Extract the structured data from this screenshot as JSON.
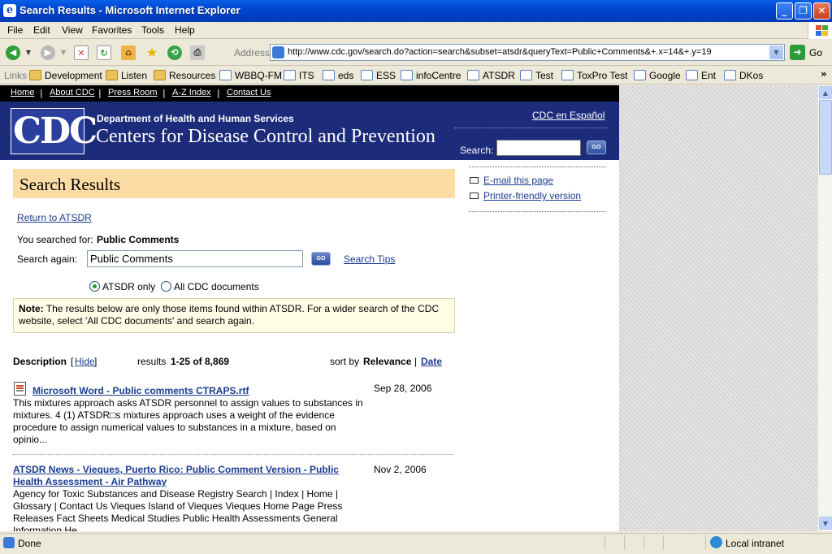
{
  "window": {
    "title": "Search Results - Microsoft Internet Explorer",
    "app_icon": "e"
  },
  "window_buttons": {
    "minimize": "_",
    "maximize": "❐",
    "close": "✕"
  },
  "menu": [
    "File",
    "Edit",
    "View",
    "Favorites",
    "Tools",
    "Help"
  ],
  "toolbar": {
    "address_label": "Address",
    "url": "http://www.cdc.gov/search.do?action=search&subset=atsdr&queryText=Public+Comments&+.x=14&+.y=19",
    "go_label": "Go"
  },
  "links_bar": {
    "label": "Links",
    "items": [
      "Development",
      "Listen",
      "Resources",
      "WBBQ-FM",
      "ITS",
      "eds",
      "ESS",
      "infoCentre",
      "ATSDR",
      "Test",
      "ToxPro Test",
      "Google",
      "Ent",
      "DKos"
    ]
  },
  "site": {
    "top_nav": [
      "Home",
      "About CDC",
      "Press Room",
      "A-Z Index",
      "Contact Us"
    ],
    "logo_text": "CDC",
    "department": "Department of Health and Human Services",
    "center_name": "Centers for Disease Control and Prevention",
    "espanol": "CDC en Español",
    "search_label": "Search:",
    "go": "GO"
  },
  "page": {
    "heading": "Search Results",
    "email_link": "E-mail this page",
    "printer_link": "Printer-friendly version",
    "return_link": "Return to ATSDR",
    "searched_for_label": "You searched for:",
    "searched_for_value": "Public Comments",
    "search_again_label": "Search again:",
    "search_again_value": "Public Comments",
    "search_tips": "Search Tips",
    "radio_atsdr": "ATSDR only",
    "radio_all": "All CDC documents",
    "note_label": "Note:",
    "note_text": "The results below are only those items found within ATSDR. For a wider search of the CDC website, select 'All CDC documents' and search again.",
    "description_label": "Description",
    "hide_link": "Hide",
    "results_prefix": "results",
    "results_range": "1-25 of 8,869",
    "sort_by": "sort by",
    "relevance": "Relevance",
    "date_link": "Date"
  },
  "results": [
    {
      "title": "Microsoft Word - Public comments CTRAPS.rtf",
      "date": "Sep 28, 2006",
      "description": "This mixtures approach asks ATSDR personnel to assign values to substances in mixtures. 4 (1) ATSDR□s mixtures approach uses a weight of the evidence procedure to assign numerical values to substances in a mixture, based on opinio..."
    },
    {
      "title": "ATSDR News - Vieques, Puerto Rico: Public Comment Version - Public Health Assessment - Air Pathway",
      "date": "Nov 2, 2006",
      "description": "Agency for Toxic Substances and Disease Registry Search | Index | Home | Glossary | Contact Us Vieques Island of Vieques Vieques Home Page Press Releases Fact Sheets Medical Studies Public Health Assessments General Information He..."
    }
  ],
  "status": {
    "text": "Done",
    "zone": "Local intranet"
  },
  "colors": {
    "banner": "#1c2c7a",
    "heading_bg": "#fcdca5",
    "link": "#1a3c8f",
    "note_bg": "#fffde6"
  }
}
